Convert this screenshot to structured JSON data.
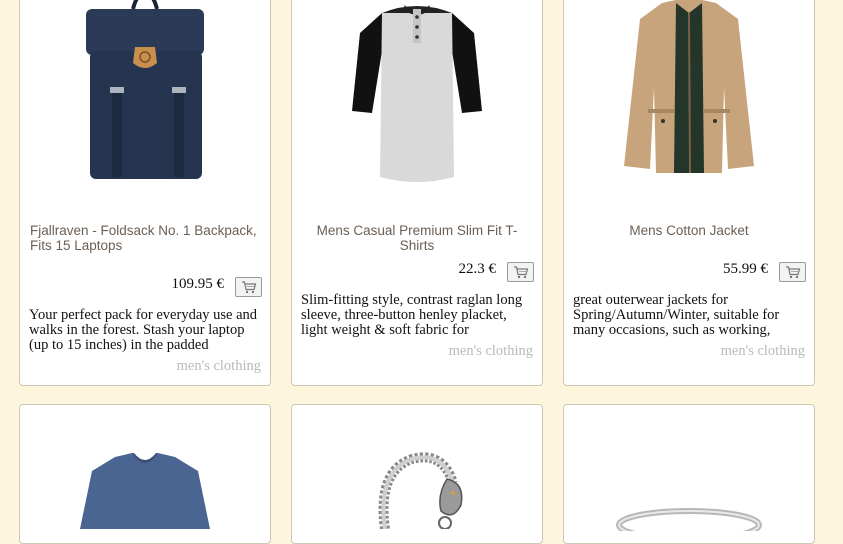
{
  "products": [
    {
      "title": "Fjallraven - Foldsack No. 1 Backpack, Fits 15 Laptops",
      "price": "109.95 €",
      "description": "Your perfect pack for everyday use and walks in the forest. Stash your laptop (up to 15 inches) in the padded",
      "category": "men's clothing",
      "image_icon": "backpack-image"
    },
    {
      "title": "Mens Casual Premium Slim Fit T-Shirts",
      "price": "22.3 €",
      "description": "Slim-fitting style, contrast raglan long sleeve, three-button henley placket, light weight & soft fabric for",
      "category": "men's clothing",
      "image_icon": "tshirt-image"
    },
    {
      "title": "Mens Cotton Jacket",
      "price": "55.99 €",
      "description": "great outerwear jackets for Spring/Autumn/Winter, suitable for many occasions, such as working,",
      "category": "men's clothing",
      "image_icon": "jacket-image"
    },
    {
      "image_icon": "sweater-image"
    },
    {
      "image_icon": "bracelet-image"
    },
    {
      "image_icon": "ring-image"
    }
  ],
  "colors": {
    "page_background": "#fdf6dc",
    "card_border": "#cfc8b8",
    "title_text": "#6b5f55",
    "category_text": "#b9b9b9"
  }
}
